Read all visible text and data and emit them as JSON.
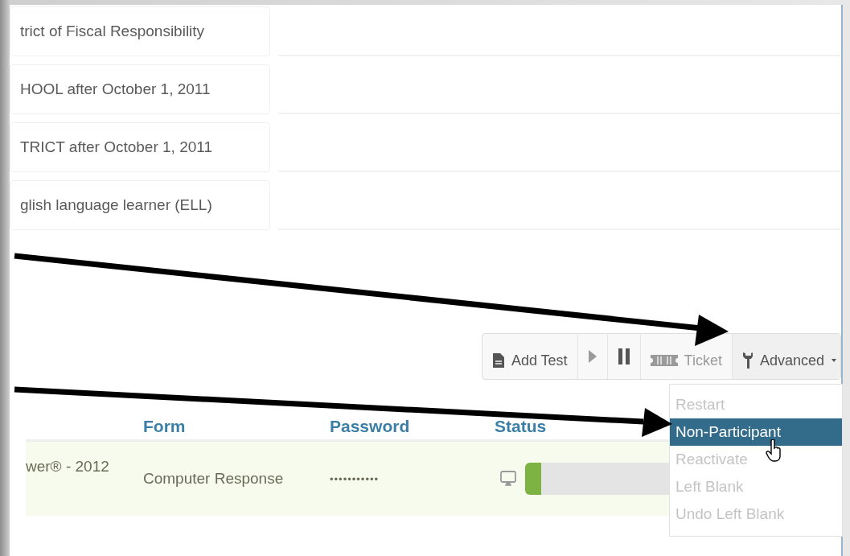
{
  "criteria": [
    {
      "text": "trict of Fiscal Responsibility"
    },
    {
      "text": "HOOL after October 1, 2011"
    },
    {
      "text": "TRICT after October 1, 2011"
    },
    {
      "text": "glish language learner (ELL)"
    }
  ],
  "toolbar": {
    "buttons": [
      {
        "kind": "add",
        "label": "Add Test",
        "disabled": false
      },
      {
        "kind": "play",
        "disabled": true
      },
      {
        "kind": "pause",
        "disabled": false
      },
      {
        "kind": "ticket",
        "label": "Ticket",
        "disabled": true
      },
      {
        "kind": "advanced",
        "label": "Advanced",
        "disabled": false
      }
    ]
  },
  "dropdown": {
    "items": [
      {
        "label": "Restart",
        "disabled": true,
        "selected": false
      },
      {
        "label": "Non-Participant",
        "disabled": false,
        "selected": true
      },
      {
        "label": "Reactivate",
        "disabled": true,
        "selected": false
      },
      {
        "label": "Left Blank",
        "disabled": true,
        "selected": false
      },
      {
        "label": "Undo Left Blank",
        "disabled": true,
        "selected": false
      }
    ]
  },
  "table": {
    "columns": [
      "Form",
      "Password",
      "Status"
    ],
    "rows": [
      {
        "column_1": "wer® - 2012",
        "form": "Computer Response",
        "password": "•••••••••••",
        "status": {
          "level": 0.06
        }
      }
    ]
  }
}
